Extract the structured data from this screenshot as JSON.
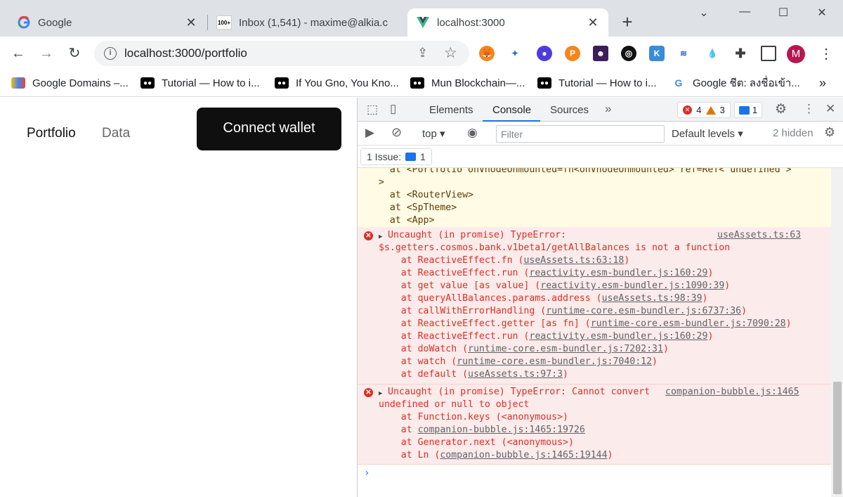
{
  "tabs": [
    {
      "title": "Google",
      "favicon": "google-g-icon"
    },
    {
      "title": "Inbox (1,541) - maxime@alkia.c",
      "favicon": "gmail-icon",
      "badge": "100+"
    },
    {
      "title": "localhost:3000",
      "favicon": "vue-icon"
    }
  ],
  "window_controls": {
    "dropdown": "⌄",
    "minimize": "—",
    "maximize": "☐",
    "close": "✕"
  },
  "omnibox": {
    "url": "localhost:3000/portfolio"
  },
  "profile_initial": "M",
  "bookmarks": [
    {
      "label": "Google Domains –...",
      "icon": "google-domains-icon"
    },
    {
      "label": "Tutorial — How to i...",
      "icon": "medium-icon"
    },
    {
      "label": "If You Gno, You Kno...",
      "icon": "medium-icon"
    },
    {
      "label": "Mun Blockchain—...",
      "icon": "medium-icon"
    },
    {
      "label": "Tutorial — How to i...",
      "icon": "medium-icon"
    },
    {
      "label": "Google ชีต: ลงชื่อเข้า...",
      "icon": "google-g-icon"
    }
  ],
  "bookmarks_more": "»",
  "page": {
    "nav": [
      {
        "label": "Portfolio"
      },
      {
        "label": "Data"
      }
    ],
    "connect_button": "Connect wallet"
  },
  "devtools": {
    "tabs": [
      "Elements",
      "Console",
      "Sources"
    ],
    "active_tab": "Console",
    "error_count": "4",
    "warning_count": "3",
    "message_count": "1",
    "context": "top",
    "filter_placeholder": "Filter",
    "levels": "Default levels",
    "hidden": "2 hidden",
    "issues_label": "1 Issue:",
    "issues_count": "1",
    "warning_lines": [
      "  at <Portfolio onVnodeUnmounted=fn<onVnodeUnmounted> ref=Ref< undefined >",
      ">",
      "  at <RouterView>",
      "  at <SpTheme>",
      "  at <App>"
    ],
    "error1": {
      "head": "Uncaught (in promise) TypeError:",
      "source": "useAssets.ts:63",
      "message": "$s.getters.cosmos.bank.v1beta1/getAllBalances is not a function",
      "stack": [
        {
          "fn": "    at ReactiveEffect.fn (",
          "loc": "useAssets.ts:63:18",
          "end": ")"
        },
        {
          "fn": "    at ReactiveEffect.run (",
          "loc": "reactivity.esm-bundler.js:160:29",
          "end": ")"
        },
        {
          "fn": "    at get value [as value] (",
          "loc": "reactivity.esm-bundler.js:1090:39",
          "end": ")"
        },
        {
          "fn": "    at queryAllBalances.params.address (",
          "loc": "useAssets.ts:98:39",
          "end": ")"
        },
        {
          "fn": "    at callWithErrorHandling (",
          "loc": "runtime-core.esm-bundler.js:6737:36",
          "end": ")"
        },
        {
          "fn": "    at ReactiveEffect.getter [as fn] (",
          "loc": "runtime-core.esm-bundler.js:7090:28",
          "end": ")"
        },
        {
          "fn": "    at ReactiveEffect.run (",
          "loc": "reactivity.esm-bundler.js:160:29",
          "end": ")"
        },
        {
          "fn": "    at doWatch (",
          "loc": "runtime-core.esm-bundler.js:7202:31",
          "end": ")"
        },
        {
          "fn": "    at watch (",
          "loc": "runtime-core.esm-bundler.js:7040:12",
          "end": ")"
        },
        {
          "fn": "    at default (",
          "loc": "useAssets.ts:97:3",
          "end": ")"
        }
      ]
    },
    "error2": {
      "head": "Uncaught (in promise) TypeError: Cannot convert",
      "source": "companion-bubble.js:1465",
      "message": "undefined or null to object",
      "stack": [
        {
          "fn": "    at Function.keys (<anonymous>)",
          "loc": "",
          "end": ""
        },
        {
          "fn": "    at ",
          "loc": "companion-bubble.js:1465:19726",
          "end": ""
        },
        {
          "fn": "    at Generator.next (<anonymous>)",
          "loc": "",
          "end": ""
        },
        {
          "fn": "    at Ln (",
          "loc": "companion-bubble.js:1465:19144",
          "end": ")"
        }
      ]
    },
    "prompt": "›"
  },
  "colors": {
    "error": "#d93025",
    "accent": "#1a73e8",
    "warn_bg": "#fffbe5",
    "error_bg": "#fcebeb"
  }
}
